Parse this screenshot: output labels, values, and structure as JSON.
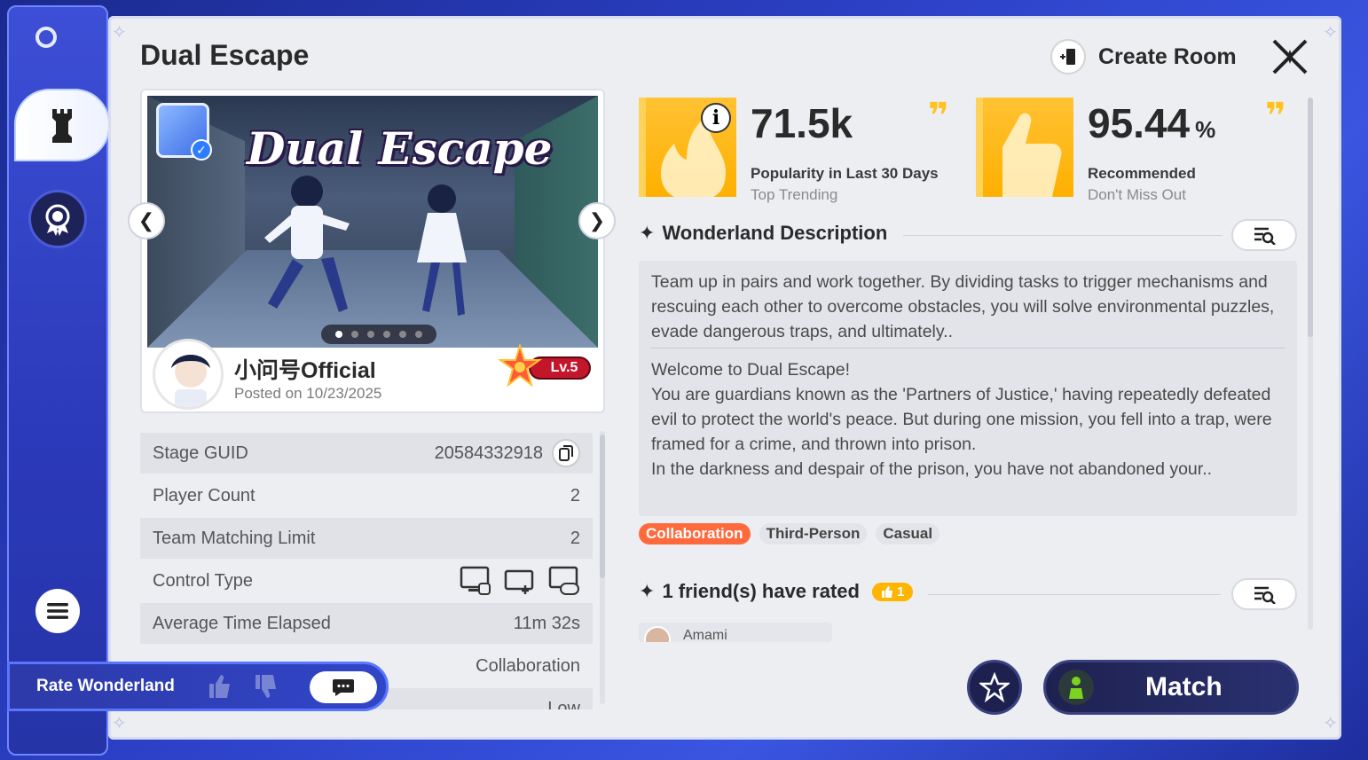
{
  "title": "Dual Escape",
  "header": {
    "create_room_label": "Create Room"
  },
  "hero": {
    "title_art": "Dual Escape",
    "slide_count": 6,
    "active_slide": 1
  },
  "author": {
    "name": "小问号Official",
    "posted": "Posted on 10/23/2025",
    "level": "Lv.5"
  },
  "info_rows": [
    {
      "label": "Stage GUID",
      "value": "20584332918"
    },
    {
      "label": "Player Count",
      "value": "2"
    },
    {
      "label": "Team Matching Limit",
      "value": "2"
    },
    {
      "label": "Control Type",
      "value": ""
    },
    {
      "label": "Average Time Elapsed",
      "value": "11m 32s"
    },
    {
      "label": "",
      "value": "Collaboration"
    },
    {
      "label": "",
      "value": "Low"
    }
  ],
  "stats": {
    "popularity": {
      "value": "71.5k",
      "label": "Popularity in Last 30 Days",
      "sub": "Top Trending"
    },
    "recommended": {
      "value": "95.44",
      "unit": "%",
      "label": "Recommended",
      "sub": "Don't Miss Out"
    }
  },
  "description": {
    "heading": "Wonderland Description",
    "summary": "Team up in pairs and work together. By dividing tasks to trigger mechanisms and rescuing each other to overcome obstacles, you will solve environmental puzzles, evade dangerous traps, and ultimately..",
    "welcome": "Welcome to Dual Escape!",
    "body": "You are guardians known as the 'Partners of Justice,' having repeatedly defeated evil to protect the world's peace. But during one mission, you fell into a trap, were framed for a crime, and thrown into prison.",
    "body2": "In the darkness and despair of the prison, you have not abandoned your.."
  },
  "tags": [
    "Collaboration",
    "Third-Person",
    "Casual"
  ],
  "friends": {
    "heading": "1 friend(s) have rated",
    "count": "1",
    "first_name": "Amami"
  },
  "actions": {
    "match_label": "Match",
    "rate_label": "Rate Wonderland"
  },
  "colors": {
    "accent": "#ffb400",
    "tag_hot": "#ff6a3d",
    "dark_button": "#1e2150"
  }
}
